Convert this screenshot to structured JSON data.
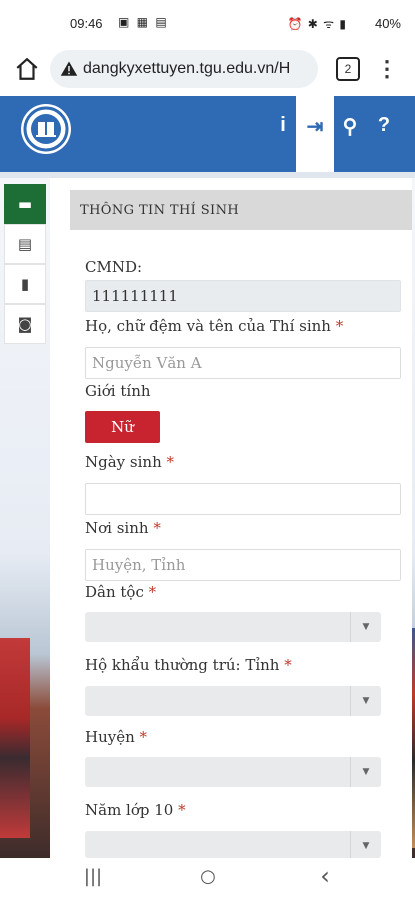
{
  "status_bar": {
    "time": "09:46",
    "left_icons": "▣ ▦ ▤",
    "right_icons": "⏰ ✱ ᯤ ▮",
    "battery": "40%"
  },
  "browser": {
    "url": "dangkyxettuyen.tgu.edu.vn/H",
    "tab_count": "2",
    "menu_glyph": "⋮"
  },
  "header": {
    "icons": [
      {
        "name": "info-icon",
        "glyph": "i"
      },
      {
        "name": "login-icon",
        "glyph": "⇥"
      },
      {
        "name": "search-icon",
        "glyph": "⚲"
      },
      {
        "name": "help-icon",
        "glyph": "?"
      }
    ],
    "accent": "#2f6ab4"
  },
  "side_tabs": [
    {
      "name": "id-card-icon",
      "glyph": "▬",
      "active": true
    },
    {
      "name": "images-icon",
      "glyph": "▤",
      "active": false
    },
    {
      "name": "clipboard-check-icon",
      "glyph": "▮",
      "active": false
    },
    {
      "name": "money-icon",
      "glyph": "◙",
      "active": false
    }
  ],
  "form": {
    "section_title": "THÔNG TIN THÍ SINH",
    "cmnd_label": "CMND:",
    "cmnd_value": "111111111",
    "name_label": "Họ, chữ đệm và tên của Thí sinh",
    "name_placeholder": "Nguyễn Văn A",
    "gender_label": "Giới tính",
    "gender_value": "Nữ",
    "dob_label": "Ngày sinh",
    "dob_value": "",
    "birthplace_label": "Nơi sinh",
    "birthplace_placeholder": "Huyện, Tỉnh",
    "ethnicity_label": "Dân tộc",
    "province_label": "Hộ khẩu thường trú: Tỉnh",
    "district_label": "Huyện",
    "grade10_label": "Năm lớp 10",
    "required_mark": "*",
    "dropdown_arrow": "▼"
  },
  "nav": {
    "recent": "|||",
    "home": "○",
    "back": "‹"
  }
}
